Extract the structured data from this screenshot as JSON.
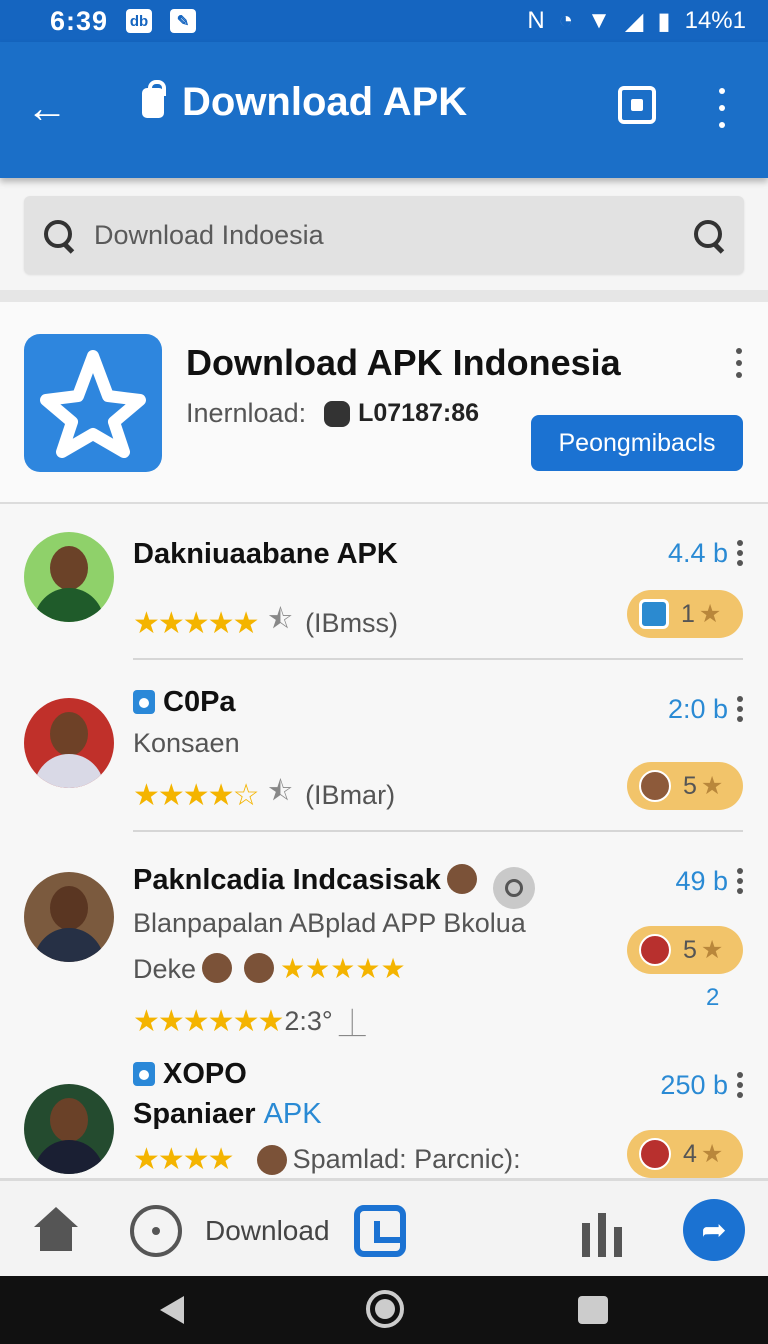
{
  "status": {
    "time": "6:39",
    "icon1": "db",
    "battery": "14%1"
  },
  "appbar": {
    "title": "Download APK"
  },
  "search": {
    "placeholder": "Download Indoesia"
  },
  "featured": {
    "title": "Download APK Indonesia",
    "label": "Inernload:",
    "count": "L07187:86",
    "button": "Peongmibacls"
  },
  "items": [
    {
      "name": "Dakniuaabane APK",
      "rating_text": "(IBmss)",
      "size": "4.4 b",
      "badge": "1"
    },
    {
      "name": "C0Pa",
      "sub": "Konsaen",
      "rating_text": "(IBmar)",
      "size": "2:0 b",
      "badge": "5"
    },
    {
      "name": "Paknlcadia Indcasisak",
      "sub": "Blanpapalan ABplad APP Bkolua",
      "sub2": "Deke",
      "rating_text": "2:3°",
      "size": "49 b",
      "badge": "5",
      "extra": "2"
    },
    {
      "name": "XOPO",
      "sub_a": "Spaniaer",
      "sub_b": "APK",
      "rating_text": "Spamlad: Parcnic):",
      "size": "250 b",
      "badge": "4"
    }
  ],
  "navbar": {
    "label": "Download"
  },
  "colors": {
    "primary": "#1b6fc8",
    "accent": "#2a8ad4",
    "star": "#f4b400",
    "badge": "#f2c46a"
  }
}
